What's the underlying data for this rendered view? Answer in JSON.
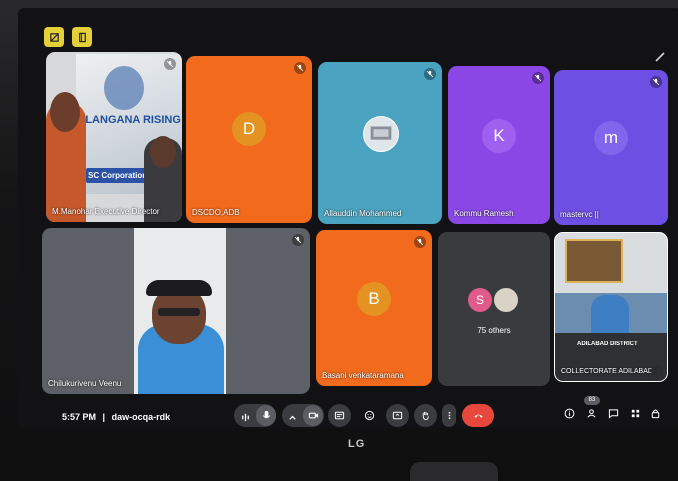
{
  "top_buttons": [
    {
      "icon": "camera-off-icon"
    },
    {
      "icon": "door-icon"
    }
  ],
  "tiles": [
    {
      "name": "M.Manohar Executive Director",
      "sign_text": "ELANGANA RISING",
      "banner_text": "SC Corporation Adilabad"
    },
    {
      "name": "DSCDO,ADB",
      "initial": "D"
    },
    {
      "name": "Allauddin Mohammed"
    },
    {
      "name": "Kommu Ramesh",
      "initial": "K"
    },
    {
      "name": "mastervc ||",
      "initial": "m"
    },
    {
      "name": "Chilukurivenu Veenu"
    },
    {
      "name": "Basani venkataramana",
      "initial": "B"
    },
    {
      "others_initial": "S",
      "others_label": "75 others"
    },
    {
      "name": "COLLECTORATE ADILABAD",
      "banner_text": "ADILABAD DISTRICT"
    }
  ],
  "status": {
    "time": "5:57 PM",
    "separator": "|",
    "meeting_code": "daw-ocqa-rdk"
  },
  "controls": [
    {
      "icon": "audio-levels-icon"
    },
    {
      "icon": "microphone-icon"
    },
    {
      "icon": "chevron-up-icon"
    },
    {
      "icon": "camera-icon"
    },
    {
      "icon": "captions-icon"
    },
    {
      "icon": "emoji-icon"
    },
    {
      "icon": "present-screen-icon"
    },
    {
      "icon": "raise-hand-icon"
    },
    {
      "icon": "more-options-icon"
    },
    {
      "icon": "end-call-icon"
    }
  ],
  "right_icons": [
    {
      "icon": "info-icon"
    },
    {
      "icon": "people-icon",
      "badge": "83"
    },
    {
      "icon": "chat-icon"
    },
    {
      "icon": "activities-icon"
    },
    {
      "icon": "host-controls-icon"
    }
  ],
  "monitor_brand": "LG",
  "colors": {
    "orange": "#f26b1d",
    "teal": "#4aa3c0",
    "purple": "#8a47e6",
    "violet": "#6d4fe3",
    "dark_tile": "#3a3b3e",
    "end_call": "#e8483b",
    "top_button": "#e4d13a"
  }
}
